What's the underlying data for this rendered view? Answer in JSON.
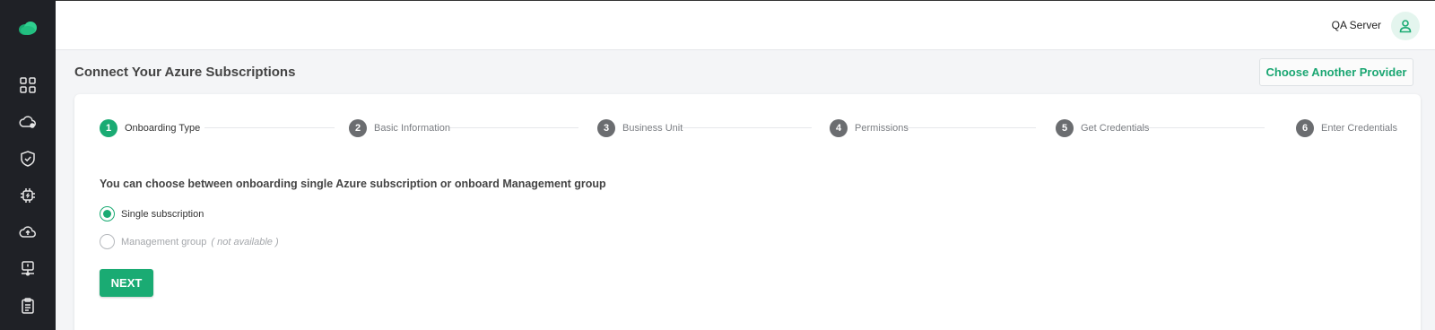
{
  "colors": {
    "accent": "#1aab73",
    "sidebar_bg": "#1f2126"
  },
  "sidebar": {
    "logo_icon": "cloud-logo-icon",
    "items": [
      {
        "icon": "dashboard-grid-icon"
      },
      {
        "icon": "cloud-alert-icon"
      },
      {
        "icon": "shield-check-icon"
      },
      {
        "icon": "chip-icon"
      },
      {
        "icon": "cloud-upload-icon"
      },
      {
        "icon": "monitor-network-icon"
      },
      {
        "icon": "clipboard-icon"
      }
    ]
  },
  "topbar": {
    "server_name": "QA Server",
    "avatar_icon": "user-icon"
  },
  "header": {
    "title": "Connect Your Azure Subscriptions",
    "choose_provider_label": "Choose Another Provider"
  },
  "stepper": {
    "steps": [
      {
        "number": "1",
        "label": "Onboarding Type",
        "active": true
      },
      {
        "number": "2",
        "label": "Basic Information",
        "active": false
      },
      {
        "number": "3",
        "label": "Business Unit",
        "active": false
      },
      {
        "number": "4",
        "label": "Permissions",
        "active": false
      },
      {
        "number": "5",
        "label": "Get Credentials",
        "active": false
      },
      {
        "number": "6",
        "label": "Enter Credentials",
        "active": false
      }
    ]
  },
  "form": {
    "question": "You can choose between onboarding single Azure subscription or onboard Management group",
    "options": [
      {
        "label": "Single subscription",
        "selected": true,
        "disabled": false,
        "note": ""
      },
      {
        "label": "Management group",
        "selected": false,
        "disabled": true,
        "note": "( not available )"
      }
    ],
    "next_label": "NEXT"
  }
}
